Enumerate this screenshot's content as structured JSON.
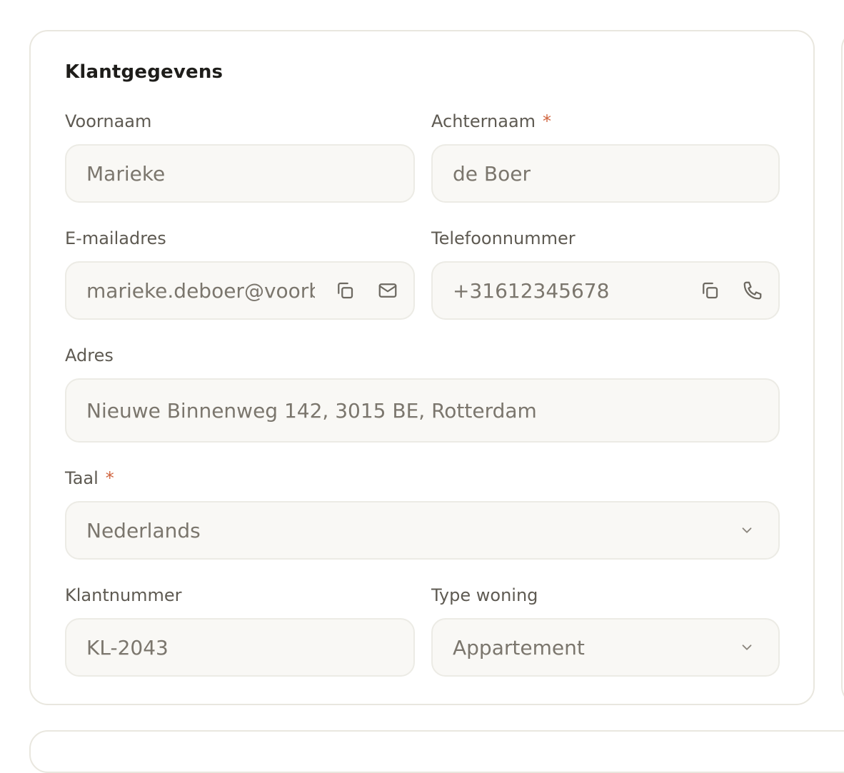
{
  "section": {
    "title": "Klantgegevens"
  },
  "fields": {
    "first_name": {
      "label": "Voornaam",
      "value": "Marieke"
    },
    "last_name": {
      "label": "Achternaam",
      "required_mark": "*",
      "value": "de Boer"
    },
    "email": {
      "label": "E-mailadres",
      "value": "marieke.deboer@voorbeeld.nl"
    },
    "phone": {
      "label": "Telefoonnummer",
      "value": "+31612345678"
    },
    "address": {
      "label": "Adres",
      "value": "Nieuwe Binnenweg 142, 3015 BE, Rotterdam"
    },
    "language": {
      "label": "Taal",
      "required_mark": "*",
      "value": "Nederlands"
    },
    "customer_number": {
      "label": "Klantnummer",
      "value": "KL-2043"
    },
    "house_type": {
      "label": "Type woning",
      "value": "Appartement"
    }
  },
  "icons": {
    "copy": "copy-icon",
    "mail": "mail-icon",
    "phone": "phone-icon",
    "chevron": "chevron-down-icon"
  },
  "colors": {
    "required": "#d0643e",
    "card_border": "#e9e7df",
    "input_background": "#f9f8f5"
  }
}
